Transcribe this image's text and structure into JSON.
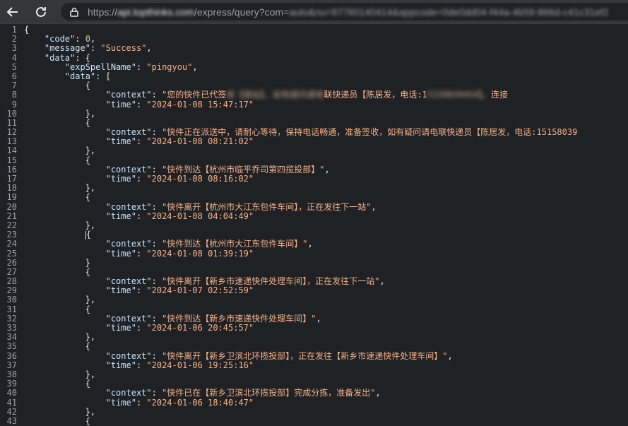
{
  "browser": {
    "url_scheme": "https://",
    "url_host": "api.topthinks.com",
    "url_path": "/express/query?com=",
    "url_tail": "auto&nu=97760140414&appcode=0de0dd04-f44a-4b59-866d-c41c31ef2"
  },
  "json": {
    "code_key": "\"code\"",
    "code_val": "0",
    "message_key": "\"message\"",
    "message_val": "\"Success\"",
    "data_key": "\"data\"",
    "spell_key": "\"expSpellName\"",
    "spell_val": "\"pingyou\"",
    "inner_data_key": "\"data\"",
    "context_key": "\"context\"",
    "time_key": "\"time\"",
    "entries": [
      {
        "context_visible": "\"您的快件已代签收【驿站】，如有疑问请电联快递员【陈居发，电话:15158039454】。连接",
        "time": "\"2024-01-08 15:47:17\""
      },
      {
        "context_visible": "\"快件正在派送中，请耐心等待，保持电话畅通，准备签收，如有疑问请电联快递员【陈居发，电话:15158039",
        "time": "\"2024-01-08 08:21:02\""
      },
      {
        "context_visible": "\"快件到达【杭州市临平乔司第四揽投部】\"",
        "time": "\"2024-01-08 08:16:02\""
      },
      {
        "context_visible": "\"快件离开【杭州市大江东包件车间】，正在发往下一站\"",
        "time": "\"2024-01-08 04:04:49\""
      },
      {
        "context_visible": "\"快件到达【杭州市大江东包件车间】\"",
        "time": "\"2024-01-08 01:39:19\""
      },
      {
        "context_visible": "\"快件离开【新乡市速递快件处理车间】，正在发往下一站\"",
        "time": "\"2024-01-07 02:52:59\""
      },
      {
        "context_visible": "\"快件到达【新乡市速递快件处理车间】\"",
        "time": "\"2024-01-06 20:45:57\""
      },
      {
        "context_visible": "\"快件离开【新乡卫滨北环揽投部】，正在发往【新乡市速递快件处理车间】\"",
        "time": "\"2024-01-06 19:25:16\""
      },
      {
        "context_visible": "\"快件已在【新乡卫滨北环揽投部】完成分拣，准备发出\"",
        "time": "\"2024-01-06 18:40:47\""
      }
    ]
  }
}
